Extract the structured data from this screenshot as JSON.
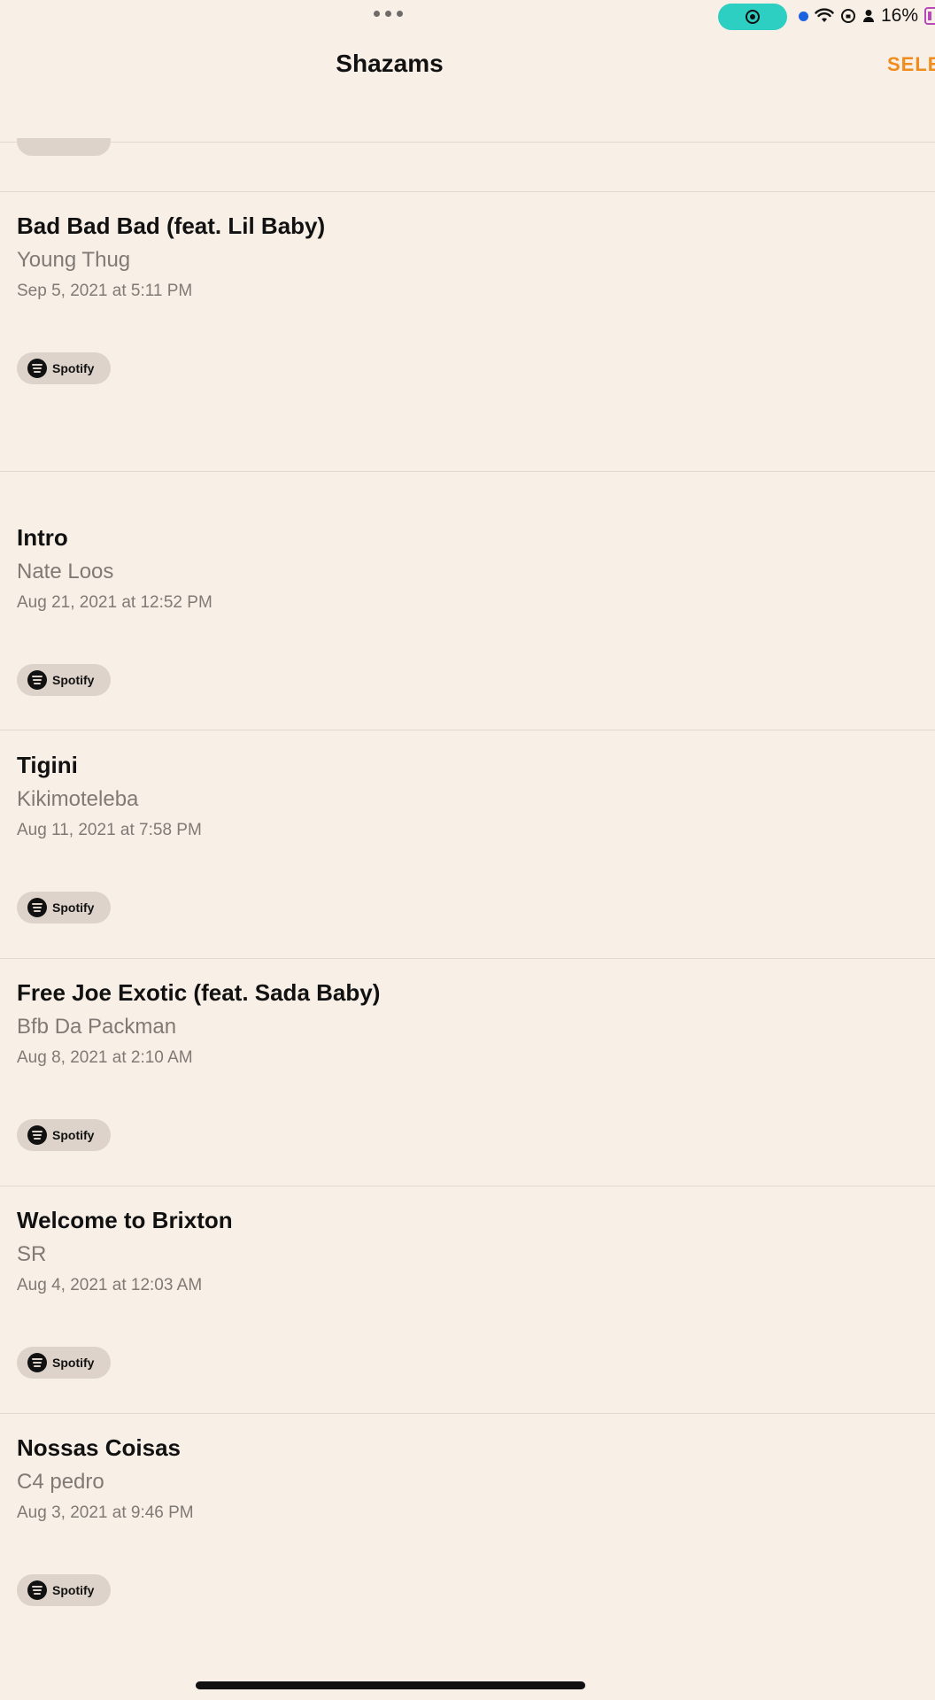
{
  "status": {
    "battery_text": "16%"
  },
  "nav": {
    "title": "Shazams",
    "select_label": "SELE"
  },
  "spotify_label": "Spotify",
  "items": [
    {
      "title": "Bad Bad Bad (feat. Lil Baby)",
      "artist": "Young Thug",
      "date": "Sep 5, 2021 at 5:11 PM",
      "service": "Spotify"
    },
    {
      "title": "Intro",
      "artist": "Nate Loos",
      "date": "Aug 21, 2021 at 12:52 PM",
      "service": "Spotify"
    },
    {
      "title": "Tigini",
      "artist": "Kikimoteleba",
      "date": "Aug 11, 2021 at 7:58 PM",
      "service": "Spotify"
    },
    {
      "title": "Free Joe Exotic (feat. Sada Baby)",
      "artist": "Bfb Da Packman",
      "date": "Aug 8, 2021 at 2:10 AM",
      "service": "Spotify"
    },
    {
      "title": "Welcome to Brixton",
      "artist": "SR",
      "date": "Aug 4, 2021 at 12:03 AM",
      "service": "Spotify"
    },
    {
      "title": "Nossas Coisas",
      "artist": "C4 pedro",
      "date": "Aug 3, 2021 at 9:46 PM",
      "service": "Spotify"
    }
  ],
  "colors": {
    "background": "#f8efe6",
    "accent": "#f08c1c",
    "record_pill": "#2ccfc1",
    "mic_dot": "#1b62e0"
  }
}
